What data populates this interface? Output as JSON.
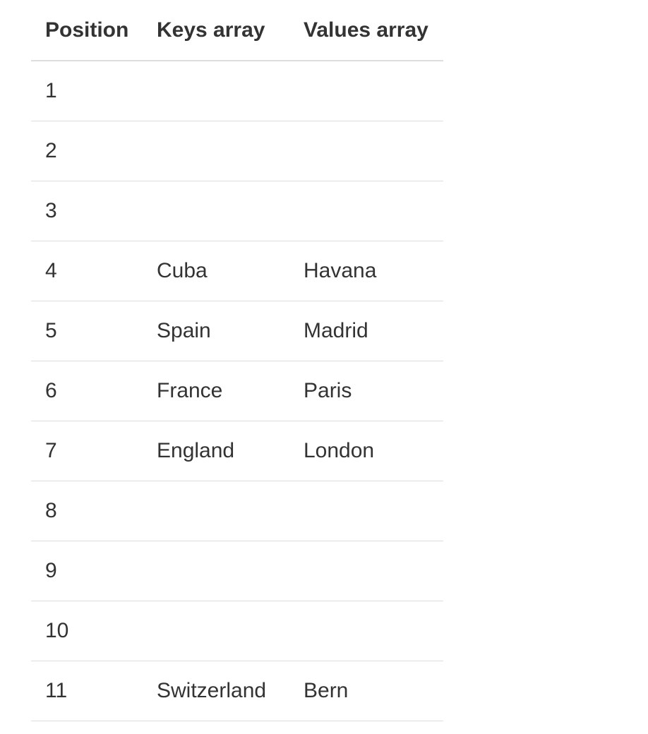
{
  "table": {
    "headers": {
      "position": "Position",
      "keys": "Keys array",
      "values": "Values array"
    },
    "rows": [
      {
        "position": "1",
        "key": "",
        "value": ""
      },
      {
        "position": "2",
        "key": "",
        "value": ""
      },
      {
        "position": "3",
        "key": "",
        "value": ""
      },
      {
        "position": "4",
        "key": "Cuba",
        "value": "Havana"
      },
      {
        "position": "5",
        "key": "Spain",
        "value": "Madrid"
      },
      {
        "position": "6",
        "key": "France",
        "value": "Paris"
      },
      {
        "position": "7",
        "key": "England",
        "value": "London"
      },
      {
        "position": "8",
        "key": "",
        "value": ""
      },
      {
        "position": "9",
        "key": "",
        "value": ""
      },
      {
        "position": "10",
        "key": "",
        "value": ""
      },
      {
        "position": "11",
        "key": "Switzerland",
        "value": "Bern"
      }
    ]
  }
}
